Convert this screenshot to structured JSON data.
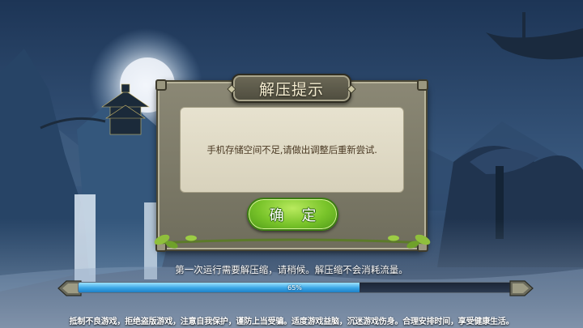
{
  "dialog": {
    "title": "解压提示",
    "message": "手机存储空间不足,请做出调整后重新尝试.",
    "confirm_label": "确 定"
  },
  "loading": {
    "status": "第一次运行需要解压缩，请稍候。解压缩不会消耗流量。",
    "progress_percent": 65,
    "progress_label": "65%"
  },
  "footer": {
    "health_notice": "抵制不良游戏，拒绝盗版游戏，注意自我保护，谨防上当受骗。适度游戏益脑，沉迷游戏伤身。合理安排时间，享受健康生活。"
  },
  "icons": [
    "corner-ornament-icon",
    "leaf-vine-icon"
  ],
  "colors": {
    "confirm_green": "#79c42a",
    "progress_blue": "#3aa6e6",
    "panel_beige": "#e7e2cf"
  }
}
